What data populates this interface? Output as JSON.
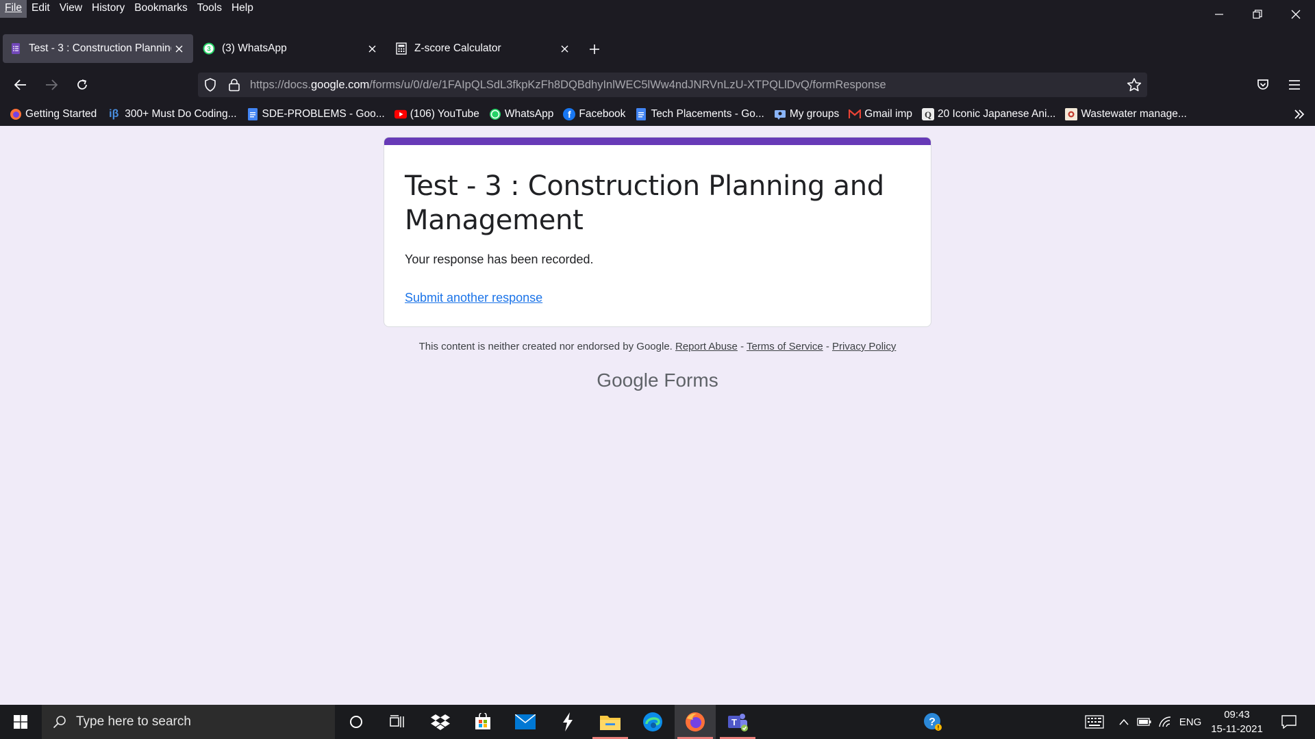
{
  "menubar": {
    "items": [
      "File",
      "Edit",
      "View",
      "History",
      "Bookmarks",
      "Tools",
      "Help"
    ]
  },
  "tabs": [
    {
      "title": "Test - 3 : Construction Planning and Management",
      "icon": "google-forms-icon",
      "active": true
    },
    {
      "title": "(3) WhatsApp",
      "icon": "whatsapp-icon",
      "badge": "3",
      "active": false
    },
    {
      "title": "Z-score Calculator",
      "icon": "calculator-icon",
      "active": false
    }
  ],
  "urlbar": {
    "prefix": "https://docs.",
    "domain": "google.com",
    "path": "/forms/u/0/d/e/1FAIpQLSdL3fkpKzFh8DQBdhyInlWEC5lWw4ndJNRVnLzU-XTPQLlDvQ/formResponse"
  },
  "bookmarks": [
    {
      "label": "Getting Started",
      "icon": "firefox-icon"
    },
    {
      "label": "300+ Must Do Coding...",
      "icon": "ib-icon"
    },
    {
      "label": "SDE-PROBLEMS - Goo...",
      "icon": "google-docs-icon"
    },
    {
      "label": "(106) YouTube",
      "icon": "youtube-icon"
    },
    {
      "label": "WhatsApp",
      "icon": "whatsapp-icon"
    },
    {
      "label": "Facebook",
      "icon": "facebook-icon"
    },
    {
      "label": "Tech Placements - Go...",
      "icon": "google-docs-icon"
    },
    {
      "label": "My groups",
      "icon": "groups-icon"
    },
    {
      "label": "Gmail imp",
      "icon": "gmail-icon"
    },
    {
      "label": "20 Iconic Japanese Ani...",
      "icon": "anime-icon"
    },
    {
      "label": "Wastewater manage...",
      "icon": "document-icon"
    }
  ],
  "form": {
    "title": "Test - 3 : Construction Planning and Management",
    "message": "Your response has been recorded.",
    "link": "Submit another response",
    "accent_color": "#673ab7"
  },
  "footer": {
    "note": "This content is neither created nor endorsed by Google.",
    "report_abuse": "Report Abuse",
    "sep1": " - ",
    "terms": "Terms of Service",
    "sep2": " - ",
    "privacy": "Privacy Policy",
    "brand_google": "Google",
    "brand_forms": "Forms"
  },
  "taskbar": {
    "search_placeholder": "Type here to search",
    "language": "ENG",
    "time": "09:43",
    "date": "15-11-2021"
  }
}
